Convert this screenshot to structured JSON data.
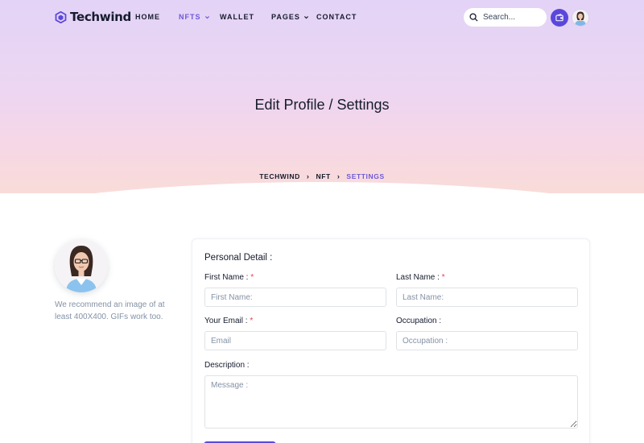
{
  "brand": {
    "name": "Techwind"
  },
  "nav": {
    "items": [
      {
        "label": "HOME",
        "has_dropdown": false,
        "active": false
      },
      {
        "label": "NFTS",
        "has_dropdown": true,
        "active": true
      },
      {
        "label": "WALLET",
        "has_dropdown": false,
        "active": false
      },
      {
        "label": "PAGES",
        "has_dropdown": true,
        "active": false
      },
      {
        "label": "CONTACT",
        "has_dropdown": false,
        "active": false
      }
    ],
    "search_placeholder": "Search...",
    "icons": {
      "search": "search-icon",
      "wallet": "wallet-icon",
      "avatar": "user-avatar"
    }
  },
  "hero": {
    "title": "Edit Profile / Settings",
    "breadcrumb": [
      "TECHWIND",
      "NFT",
      "SETTINGS"
    ]
  },
  "profile": {
    "note": "We recommend an image of at least 400X400. GIFs work too."
  },
  "form": {
    "title": "Personal Detail :",
    "first_name": {
      "label": "First Name :",
      "required": "*",
      "placeholder": "First Name:"
    },
    "last_name": {
      "label": "Last Name :",
      "required": "*",
      "placeholder": "Last Name:"
    },
    "email": {
      "label": "Your Email :",
      "required": "*",
      "placeholder": "Email"
    },
    "occupation": {
      "label": "Occupation :",
      "placeholder": "Occupation :"
    },
    "description": {
      "label": "Description :",
      "placeholder": "Message :"
    }
  },
  "colors": {
    "accent": "#5a48db",
    "active_nav": "#6e59d8",
    "required": "#e43f52",
    "muted_text": "#8492a6"
  }
}
